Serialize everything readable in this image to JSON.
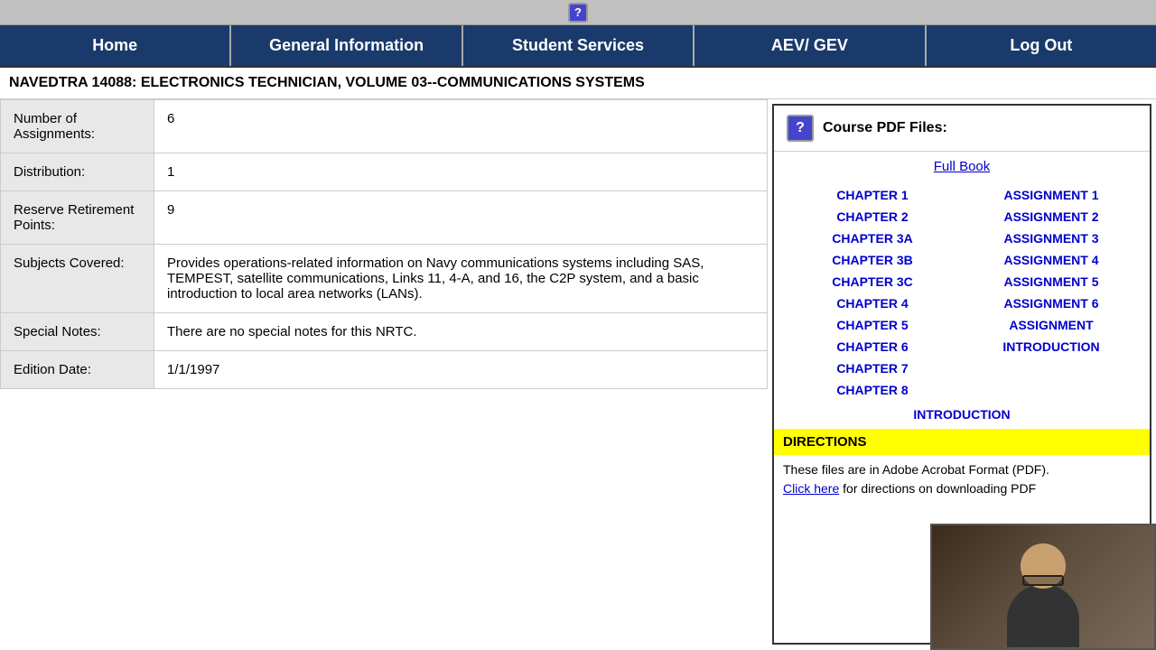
{
  "topbar": {
    "help_icon_label": "?"
  },
  "nav": {
    "items": [
      {
        "label": "Home",
        "id": "home"
      },
      {
        "label": "General Information",
        "id": "general-info"
      },
      {
        "label": "Student Services",
        "id": "student-services"
      },
      {
        "label": "AEV/ GEV",
        "id": "aev-gev"
      },
      {
        "label": "Log Out",
        "id": "log-out"
      }
    ]
  },
  "page_title": "NAVEDTRA 14088: ELECTRONICS TECHNICIAN, VOLUME 03--COMMUNICATIONS SYSTEMS",
  "info_rows": [
    {
      "label": "Number of Assignments:",
      "value": "6"
    },
    {
      "label": "Distribution:",
      "value": "1"
    },
    {
      "label": "Reserve Retirement Points:",
      "value": "9"
    },
    {
      "label": "Subjects Covered:",
      "value": "Provides operations-related information on Navy communications systems including SAS, TEMPEST, satellite communications, Links 11, 4-A, and 16, the C2P system, and a basic introduction to local area networks (LANs)."
    },
    {
      "label": "Special Notes:",
      "value": "There are no special notes for this NRTC."
    },
    {
      "label": "Edition Date:",
      "value": "1/1/1997"
    }
  ],
  "right_panel": {
    "header_icon": "?",
    "header_title": "Course PDF Files:",
    "full_book_label": "Full Book",
    "chapters": [
      "CHAPTER 1",
      "CHAPTER 2",
      "CHAPTER 3A",
      "CHAPTER 3B",
      "CHAPTER 3C",
      "CHAPTER 4",
      "CHAPTER 5",
      "CHAPTER 6",
      "CHAPTER 7",
      "CHAPTER 8"
    ],
    "assignments": [
      "ASSIGNMENT 1",
      "ASSIGNMENT 2",
      "ASSIGNMENT 3",
      "ASSIGNMENT 4",
      "ASSIGNMENT 5",
      "ASSIGNMENT 6",
      "ASSIGNMENT",
      "INTRODUCTION"
    ],
    "intro_label": "INTRODUCTION",
    "directions_label": "DIRECTIONS",
    "directions_text": "These files are in Adobe Acrobat Format (PDF).",
    "click_here_label": "Click here",
    "directions_text2": " for directions on downloading PDF"
  }
}
